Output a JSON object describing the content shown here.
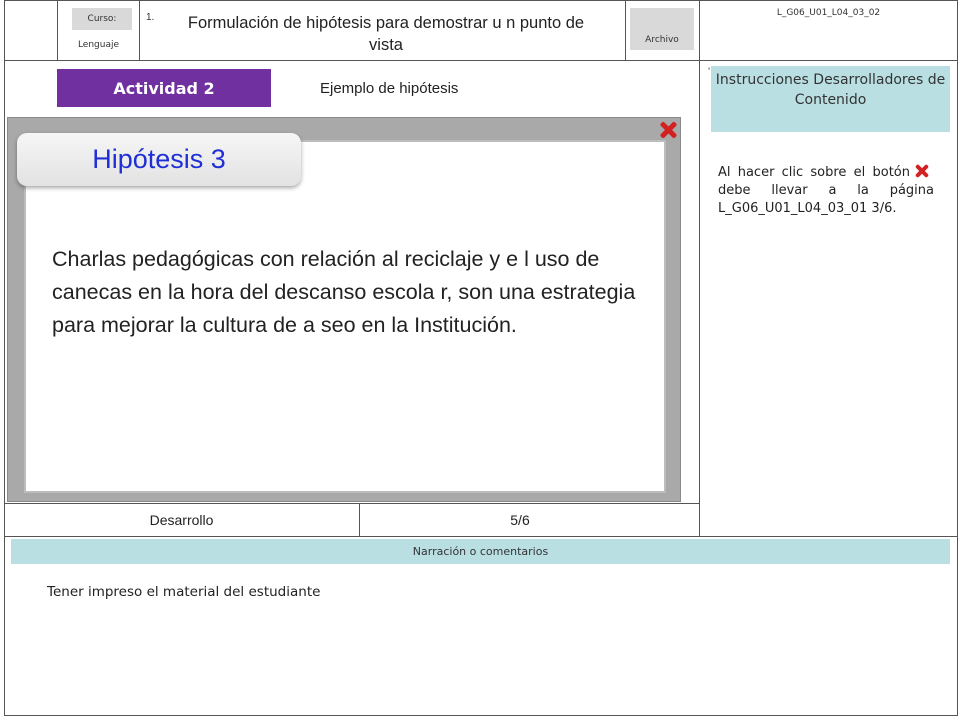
{
  "header": {
    "course_label": "Curso:",
    "course_value": "Lenguaje",
    "number": "1.",
    "title": "Formulación de hipótesis para demostrar u n punto de vista",
    "file_label": "Archivo",
    "code": "L_G06_U01_L04_03_02"
  },
  "activity": {
    "badge": "Actividad 2",
    "subtitle": "Ejemplo de hipótesis"
  },
  "slide": {
    "hypothesis_title": "Hipótesis 3",
    "hypothesis_text": "Charlas pedagógicas con relación al reciclaje y e l uso de canecas en la hora del descanso escola r, son una estrategia para mejorar la cultura de a seo en la Institución."
  },
  "instructions": {
    "heading": "Instrucciones Desarrolladores de Contenido",
    "text_before": "Al hacer clic sobre el botón",
    "text_after": "debe llevar a la página L_G06_U01_L04_03_01 3/6.",
    "marker": "'"
  },
  "footer_row": {
    "section": "Desarrollo",
    "page": "5/6"
  },
  "narration": {
    "heading": "Narración o comentarios",
    "text": "Tener impreso el material del estudiante"
  },
  "colors": {
    "activity_badge": "#7030a0",
    "teal": "#b9dfe2",
    "close_icon": "#d32020",
    "hypothesis_title": "#1f2fd6"
  }
}
